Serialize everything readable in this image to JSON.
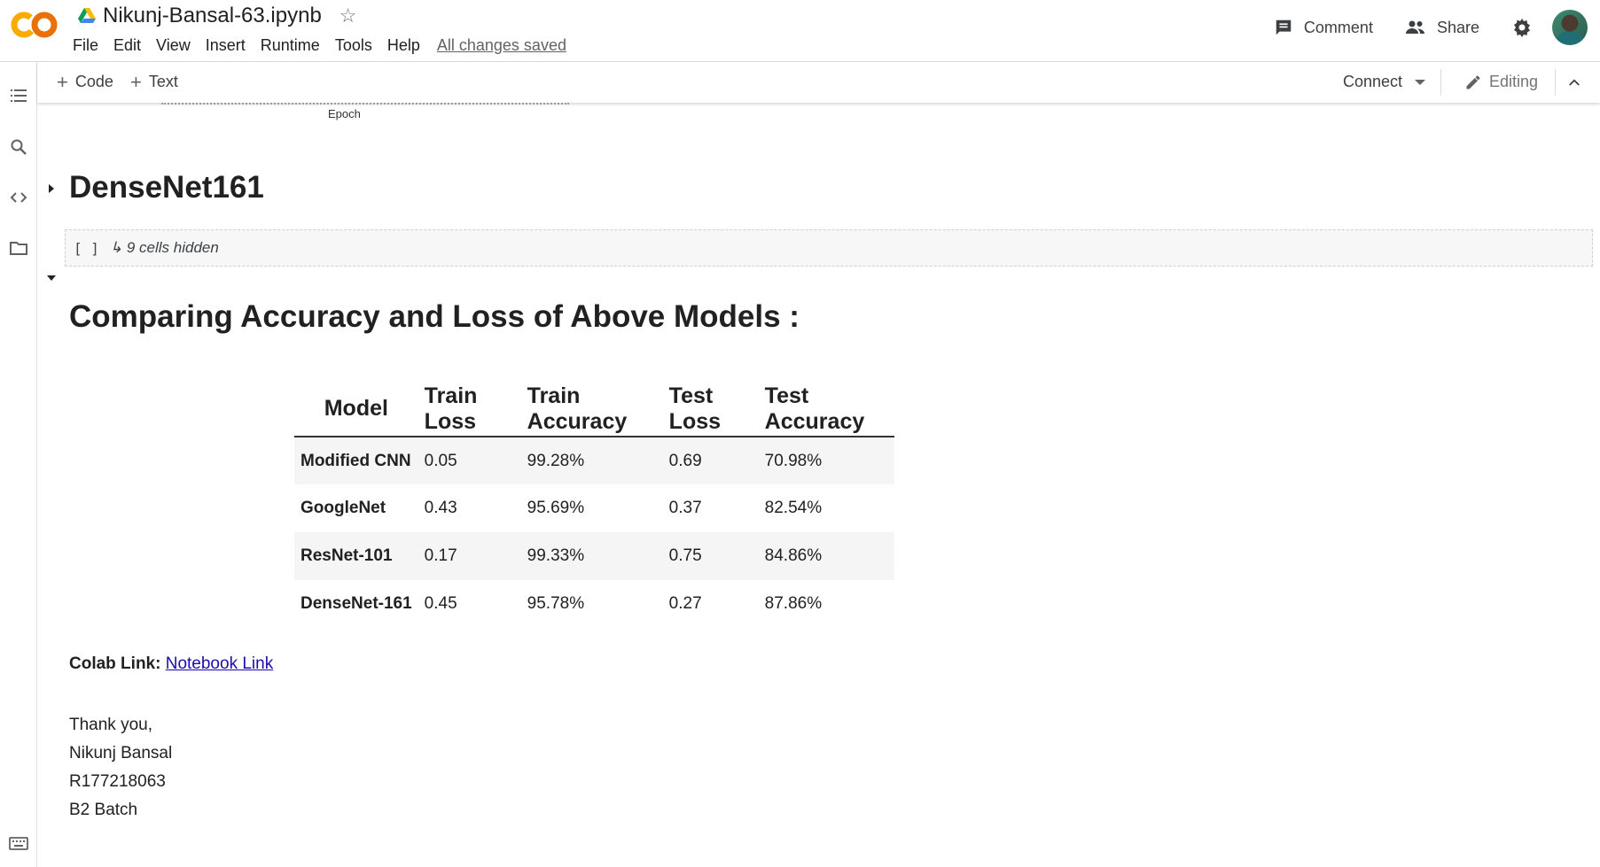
{
  "header": {
    "doc_title": "Nikunj-Bansal-63.ipynb",
    "menu": [
      "File",
      "Edit",
      "View",
      "Insert",
      "Runtime",
      "Tools",
      "Help"
    ],
    "saved_status": "All changes saved",
    "comment_label": "Comment",
    "share_label": "Share"
  },
  "toolbar": {
    "code_label": "Code",
    "text_label": "Text",
    "connect_label": "Connect",
    "editing_label": "Editing"
  },
  "notebook": {
    "partial_axis_label": "Epoch",
    "section1_title": "DenseNet161",
    "hidden_brackets": "[ ]",
    "hidden_cells_text": "↳ 9 cells hidden",
    "section2_title": "Comparing Accuracy and Loss of Above Models :",
    "table": {
      "headers": [
        "Model",
        "Train Loss",
        "Train Accuracy",
        "Test Loss",
        "Test Accuracy"
      ],
      "rows": [
        [
          "Modified CNN",
          "0.05",
          "99.28%",
          "0.69",
          "70.98%"
        ],
        [
          "GoogleNet",
          "0.43",
          "95.69%",
          "0.37",
          "82.54%"
        ],
        [
          "ResNet-101",
          "0.17",
          "99.33%",
          "0.75",
          "84.86%"
        ],
        [
          "DenseNet-161",
          "0.45",
          "95.78%",
          "0.27",
          "87.86%"
        ]
      ]
    },
    "colab_link_label": "Colab Link:",
    "colab_link_text": "Notebook Link",
    "signature": [
      "Thank you,",
      "Nikunj Bansal",
      "R177218063",
      "B2 Batch"
    ]
  },
  "colors": {
    "logo_orange": "#F9AB00",
    "logo_dark_orange": "#E8710A",
    "link_blue": "#1a0dab"
  }
}
